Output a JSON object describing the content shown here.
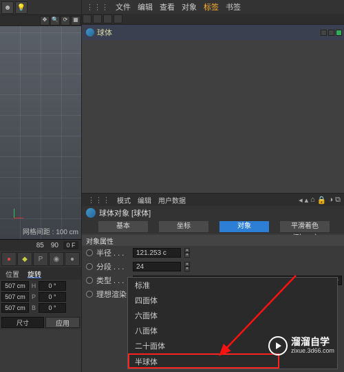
{
  "top_icons": [
    "face-icon",
    "bulb-icon"
  ],
  "viewport": {
    "grid_label": "网格间距 : 100 cm"
  },
  "timeline": {
    "a": "85",
    "b": "90",
    "c": "0 F"
  },
  "tabs_left": {
    "position": "位置",
    "rotate": "旋转"
  },
  "coords": {
    "r1": {
      "v1": "507 cm",
      "s1": "H",
      "v2": "0 °"
    },
    "r2": {
      "v1": "507 cm",
      "s1": "P",
      "v2": "0 °"
    },
    "r3": {
      "v1": "507 cm",
      "s1": "B",
      "v2": "0 °"
    }
  },
  "bottom": {
    "field": "尺寸",
    "btn": "应用"
  },
  "menu": {
    "file": "文件",
    "edit": "编辑",
    "view": "查看",
    "object": "对象",
    "tags": "标签",
    "bookmarks": "书签"
  },
  "hierarchy": {
    "item0": "球体"
  },
  "inspector": {
    "mode": "模式",
    "edit": "编辑",
    "userdata": "用户数据"
  },
  "object_title": "球体对象 [球体]",
  "tab_buttons": {
    "basic": "基本",
    "coord": "坐标",
    "object": "对象",
    "phong": "平滑着色(Phong)"
  },
  "section": "对象属性",
  "props": {
    "radius_label": "半径 . . .",
    "radius_value": "121.253 c",
    "segments_label": "分段 . . .",
    "segments_value": "24",
    "type_label": "类型 . . .",
    "type_value": "标准",
    "ideal_label": "理想渲染"
  },
  "dropdown": {
    "o0": "标准",
    "o1": "四面体",
    "o2": "六面体",
    "o3": "八面体",
    "o4": "二十面体",
    "o5": "半球体"
  },
  "watermark": {
    "brand": "溜溜自学",
    "url": "zixue.3d66.com"
  }
}
